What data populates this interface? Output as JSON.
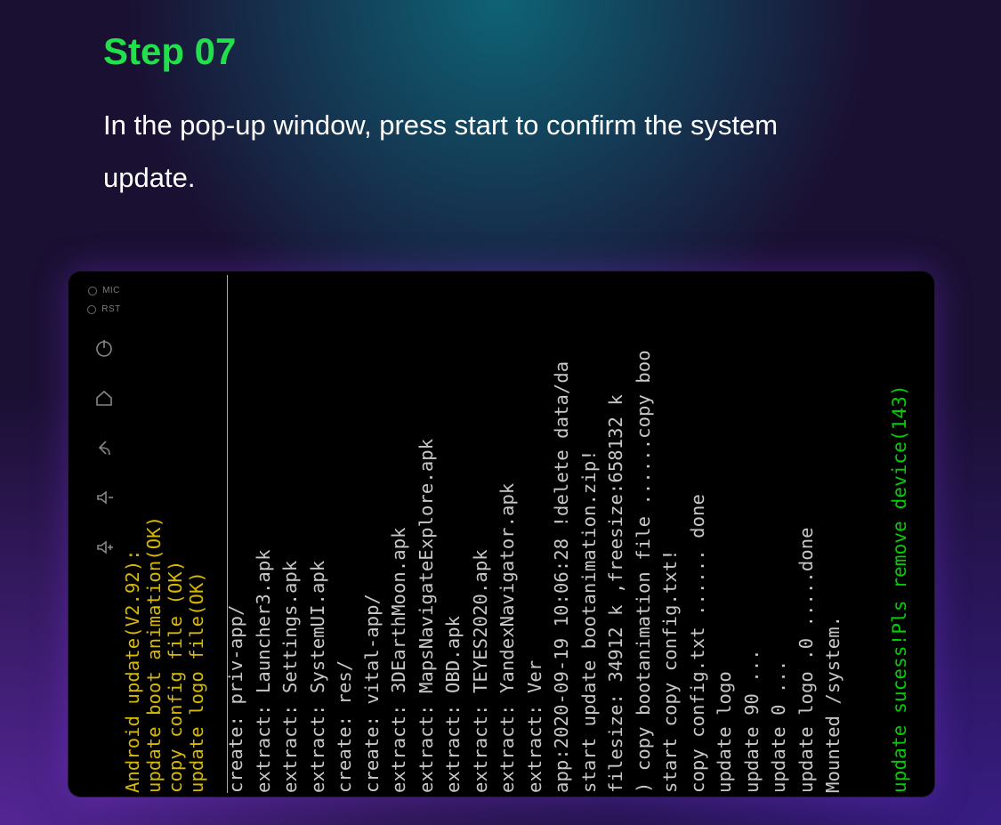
{
  "step_label": "Step 07",
  "step_desc": "In the pop-up window, press start to confirm the system update.",
  "side": {
    "mic": "MIC",
    "rst": "RST"
  },
  "header": [
    "Android update(V2.92):",
    "update boot animation(OK)",
    "copy config file (OK)",
    "update logo file(OK)"
  ],
  "body": [
    "create: priv-app/",
    "extract: Launcher3.apk",
    "extract: Settings.apk",
    "extract: SystemUI.apk",
    "create: res/",
    "create: vital-app/",
    "extract: 3DEarthMoon.apk",
    "extract: MapsNavigateExplore.apk",
    "extract: OBD.apk",
    "extract: TEYES2020.apk",
    "extract: YandexNavigator.apk",
    "extract: Ver",
    "app:2020-09-19 10:06:28 !delete  data/da",
    "start update bootanimation.zip!",
    "filesize: 34912 k ,freesize:658132 k",
    ") copy bootanimation file ......copy boo",
    "start copy config.txt!",
    "copy config.txt  ......   done",
    "update logo",
    "update 90  ...",
    "update 0   ...",
    "update logo  .0   .....done",
    "Mounted /system."
  ],
  "footer": "update sucess!Pls remove device(143)"
}
